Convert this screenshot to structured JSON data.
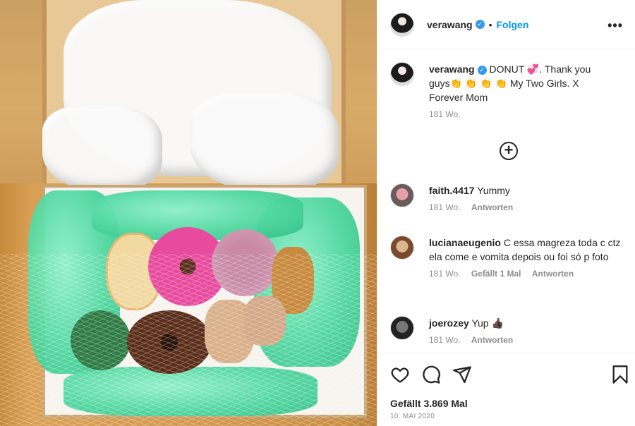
{
  "post": {
    "username": "verawang",
    "follow_label": "Folgen",
    "caption": {
      "username": "verawang",
      "text": "DONUT 💞. Thank you guys👏 👏 👏 👏 My Two Girls. X Forever Mom",
      "time": "181 Wo."
    },
    "comments": [
      {
        "username": "faith.4417",
        "text": "Yummy",
        "time": "181 Wo.",
        "likes": "",
        "reply": "Antworten"
      },
      {
        "username": "lucianaeugenio",
        "text": "C essa magreza toda c ctz ela come e vomita depois ou foi só p foto",
        "time": "181 Wo.",
        "likes": "Gefällt 1 Mal",
        "reply": "Antworten"
      },
      {
        "username": "joerozey",
        "text": "Yup 👍🏿",
        "time": "181 Wo.",
        "likes": "",
        "reply": "Antworten"
      }
    ],
    "likes_label": "Gefällt 3.869 Mal",
    "date_label": "10. MAI 2020"
  },
  "icons": [
    "more-options-icon",
    "verified-icon",
    "load-more-icon",
    "heart-icon",
    "comment-icon",
    "share-icon",
    "bookmark-icon"
  ],
  "colors": {
    "link": "#0095f6",
    "verified": "#3897f0",
    "text": "#262626",
    "muted": "#8e8e8e"
  }
}
